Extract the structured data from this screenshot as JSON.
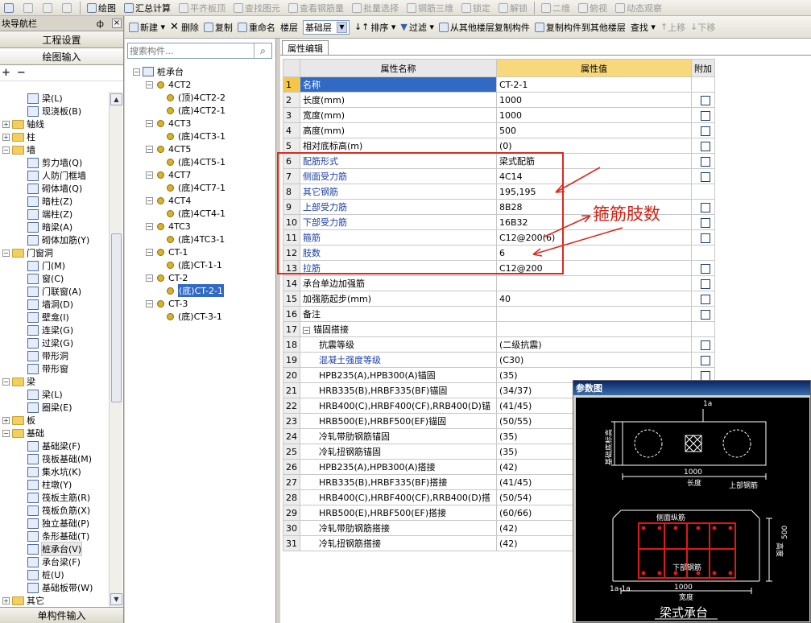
{
  "toolbar_top": {
    "items": [
      {
        "icon": "folder-open-icon",
        "label": "",
        "enabled": true
      },
      {
        "icon": "save-icon",
        "label": "",
        "enabled": false
      },
      {
        "icon": "undo-icon",
        "label": "",
        "enabled": false
      },
      {
        "icon": "redo-icon",
        "label": "",
        "enabled": false
      },
      {
        "icon": "draw-icon",
        "label": "绘图",
        "enabled": true
      },
      {
        "icon": "sigma-icon",
        "label": "汇总计算",
        "enabled": true
      },
      {
        "icon": "flat-slab-icon",
        "label": "平齐板顶",
        "enabled": false
      },
      {
        "icon": "find-element-icon",
        "label": "查找图元",
        "enabled": false
      },
      {
        "icon": "view-rebar-icon",
        "label": "查看钢筋量",
        "enabled": false
      },
      {
        "icon": "batch-select-icon",
        "label": "批量选择",
        "enabled": false
      },
      {
        "icon": "rebar-3d-icon",
        "label": "钢筋三维",
        "enabled": false
      },
      {
        "icon": "lock-icon",
        "label": "锁定",
        "enabled": false
      },
      {
        "icon": "unlock-icon",
        "label": "解锁",
        "enabled": false
      },
      {
        "icon": "2d-icon",
        "label": "二维",
        "enabled": false
      },
      {
        "icon": "view-icon",
        "label": "俯视",
        "enabled": false
      },
      {
        "icon": "dynamic-view-icon",
        "label": "动态观察",
        "enabled": false
      }
    ]
  },
  "left_panel": {
    "title": "块导航栏",
    "pin": "ф",
    "close": "×",
    "btn_project": "工程设置",
    "btn_draw": "绘图输入",
    "add_symbol": "+",
    "remove_symbol": "−",
    "tree": [
      {
        "label": "梁(L)",
        "level": 2,
        "kind": "item"
      },
      {
        "label": "现浇板(B)",
        "level": 2,
        "kind": "item"
      },
      {
        "label": "轴线",
        "level": 0,
        "kind": "folder",
        "expand": "+"
      },
      {
        "label": "柱",
        "level": 0,
        "kind": "folder",
        "expand": "+"
      },
      {
        "label": "墙",
        "level": 0,
        "kind": "folder",
        "expand": "−"
      },
      {
        "label": "剪力墙(Q)",
        "level": 2,
        "kind": "item"
      },
      {
        "label": "人防门框墙",
        "level": 2,
        "kind": "item"
      },
      {
        "label": "砌体墙(Q)",
        "level": 2,
        "kind": "item"
      },
      {
        "label": "暗柱(Z)",
        "level": 2,
        "kind": "item"
      },
      {
        "label": "端柱(Z)",
        "level": 2,
        "kind": "item"
      },
      {
        "label": "暗梁(A)",
        "level": 2,
        "kind": "item"
      },
      {
        "label": "砌体加筋(Y)",
        "level": 2,
        "kind": "item"
      },
      {
        "label": "门窗洞",
        "level": 0,
        "kind": "folder",
        "expand": "−"
      },
      {
        "label": "门(M)",
        "level": 2,
        "kind": "item"
      },
      {
        "label": "窗(C)",
        "level": 2,
        "kind": "item"
      },
      {
        "label": "门联窗(A)",
        "level": 2,
        "kind": "item"
      },
      {
        "label": "墙洞(D)",
        "level": 2,
        "kind": "item"
      },
      {
        "label": "壁龛(I)",
        "level": 2,
        "kind": "item"
      },
      {
        "label": "连梁(G)",
        "level": 2,
        "kind": "item"
      },
      {
        "label": "过梁(G)",
        "level": 2,
        "kind": "item"
      },
      {
        "label": "带形洞",
        "level": 2,
        "kind": "item"
      },
      {
        "label": "带形窗",
        "level": 2,
        "kind": "item"
      },
      {
        "label": "梁",
        "level": 0,
        "kind": "folder",
        "expand": "−"
      },
      {
        "label": "梁(L)",
        "level": 2,
        "kind": "item"
      },
      {
        "label": "圈梁(E)",
        "level": 2,
        "kind": "item"
      },
      {
        "label": "板",
        "level": 0,
        "kind": "folder",
        "expand": "+"
      },
      {
        "label": "基础",
        "level": 0,
        "kind": "folder",
        "expand": "−"
      },
      {
        "label": "基础梁(F)",
        "level": 2,
        "kind": "item"
      },
      {
        "label": "筏板基础(M)",
        "level": 2,
        "kind": "item"
      },
      {
        "label": "集水坑(K)",
        "level": 2,
        "kind": "item"
      },
      {
        "label": "柱墩(Y)",
        "level": 2,
        "kind": "item"
      },
      {
        "label": "筏板主筋(R)",
        "level": 2,
        "kind": "item"
      },
      {
        "label": "筏板负筋(X)",
        "level": 2,
        "kind": "item"
      },
      {
        "label": "独立基础(P)",
        "level": 2,
        "kind": "item"
      },
      {
        "label": "条形基础(T)",
        "level": 2,
        "kind": "item"
      },
      {
        "label": "桩承台(V)",
        "level": 2,
        "kind": "item",
        "selected": true
      },
      {
        "label": "承台梁(F)",
        "level": 2,
        "kind": "item"
      },
      {
        "label": "桩(U)",
        "level": 2,
        "kind": "item"
      },
      {
        "label": "基础板带(W)",
        "level": 2,
        "kind": "item"
      },
      {
        "label": "其它",
        "level": 0,
        "kind": "folder",
        "expand": "+"
      }
    ],
    "bottom_btn": "单构件输入"
  },
  "toolbar2": {
    "new": "新建",
    "delete": "删除",
    "copy": "复制",
    "rename": "重命名",
    "floor_label": "楼层",
    "floor_value": "基础层",
    "sort": "排序",
    "filter": "过滤",
    "copy_from": "从其他楼层复制构件",
    "copy_to": "复制构件到其他楼层",
    "find": "查找",
    "up": "上移",
    "down": "下移"
  },
  "component_tree": {
    "search_placeholder": "搜索构件...",
    "root": "桩承台",
    "groups": [
      {
        "name": "4CT2",
        "children": [
          "(顶)4CT2-2",
          "(底)4CT2-1"
        ]
      },
      {
        "name": "4CT3",
        "children": [
          "(底)4CT3-1"
        ]
      },
      {
        "name": "4CT5",
        "children": [
          "(底)4CT5-1"
        ]
      },
      {
        "name": "4CT7",
        "children": [
          "(底)4CT7-1"
        ]
      },
      {
        "name": "4CT4",
        "children": [
          "(底)4CT4-1"
        ]
      },
      {
        "name": "4TC3",
        "children": [
          "(底)4TC3-1"
        ]
      },
      {
        "name": "CT-1",
        "children": [
          "(底)CT-1-1"
        ]
      },
      {
        "name": "CT-2",
        "children": [
          "(底)CT-2-1"
        ]
      },
      {
        "name": "CT-3",
        "children": [
          "(底)CT-3-1"
        ]
      }
    ],
    "selected": "(底)CT-2-1"
  },
  "property_panel": {
    "tab": "属性编辑",
    "col_name": "属性名称",
    "col_value": "属性值",
    "col_extra": "附加",
    "rows": [
      {
        "n": "1",
        "name": "名称",
        "value": "CT-2-1",
        "blue": true,
        "check": false
      },
      {
        "n": "2",
        "name": "长度(mm)",
        "value": "1000",
        "check": true
      },
      {
        "n": "3",
        "name": "宽度(mm)",
        "value": "1000",
        "check": true
      },
      {
        "n": "4",
        "name": "高度(mm)",
        "value": "500",
        "check": true
      },
      {
        "n": "5",
        "name": "相对底标高(m)",
        "value": "(0)",
        "check": true
      },
      {
        "n": "6",
        "name": "配筋形式",
        "value": "梁式配筋",
        "blue": true,
        "check": true
      },
      {
        "n": "7",
        "name": "侧面受力筋",
        "value": "4C14",
        "blue": true,
        "check": true
      },
      {
        "n": "8",
        "name": "其它钢筋",
        "value": "195,195",
        "blue": true,
        "check": false
      },
      {
        "n": "9",
        "name": "上部受力筋",
        "value": "8B28",
        "blue": true,
        "check": true
      },
      {
        "n": "10",
        "name": "下部受力筋",
        "value": "16B32",
        "blue": true,
        "check": true
      },
      {
        "n": "11",
        "name": "箍筋",
        "value": "C12@200(6)",
        "blue": true,
        "check": true
      },
      {
        "n": "12",
        "name": "肢数",
        "value": "6",
        "blue": true,
        "check": false
      },
      {
        "n": "13",
        "name": "拉筋",
        "value": "C12@200",
        "blue": true,
        "check": true
      },
      {
        "n": "14",
        "name": "承台单边加强筋",
        "value": "",
        "check": true
      },
      {
        "n": "15",
        "name": "加强筋起步(mm)",
        "value": "40",
        "check": true
      },
      {
        "n": "16",
        "name": "备注",
        "value": "",
        "check": true
      },
      {
        "n": "17",
        "name": "锚固搭接",
        "value": "",
        "group": "−"
      },
      {
        "n": "18",
        "name": "抗震等级",
        "value": "(二级抗震)",
        "indent": true,
        "check": true
      },
      {
        "n": "19",
        "name": "混凝土强度等级",
        "value": "(C30)",
        "indent": true,
        "blue": true,
        "check": true
      },
      {
        "n": "20",
        "name": "HPB235(A),HPB300(A)锚固",
        "value": "(35)",
        "indent": true,
        "check": true
      },
      {
        "n": "21",
        "name": "HRB335(B),HRBF335(BF)锚固",
        "value": "(34/37)",
        "indent": true,
        "check": true
      },
      {
        "n": "22",
        "name": "HRB400(C),HRBF400(CF),RRB400(D)锚",
        "value": "(41/45)",
        "indent": true,
        "check": true
      },
      {
        "n": "23",
        "name": "HRB500(E),HRBF500(EF)锚固",
        "value": "(50/55)",
        "indent": true,
        "check": true
      },
      {
        "n": "24",
        "name": "冷轧带肋钢筋锚固",
        "value": "(35)",
        "indent": true,
        "check": true
      },
      {
        "n": "25",
        "name": "冷轧扭钢筋锚固",
        "value": "(35)",
        "indent": true,
        "check": true
      },
      {
        "n": "26",
        "name": "HPB235(A),HPB300(A)搭接",
        "value": "(42)",
        "indent": true,
        "check": true
      },
      {
        "n": "27",
        "name": "HRB335(B),HRBF335(BF)搭接",
        "value": "(41/45)",
        "indent": true,
        "check": true
      },
      {
        "n": "28",
        "name": "HRB400(C),HRBF400(CF),RRB400(D)搭",
        "value": "(50/54)",
        "indent": true,
        "check": true
      },
      {
        "n": "29",
        "name": "HRB500(E),HRBF500(EF)搭接",
        "value": "(60/66)",
        "indent": true,
        "check": true
      },
      {
        "n": "30",
        "name": "冷轧带肋钢筋搭接",
        "value": "(42)",
        "indent": true,
        "check": true
      },
      {
        "n": "31",
        "name": "冷轧扭钢筋搭接",
        "value": "(42)",
        "indent": true,
        "check": true
      }
    ]
  },
  "annotation": {
    "text": "箍筋肢数",
    "color": "#d62114"
  },
  "param_window": {
    "title": "参数图",
    "label_top_dim": "1000",
    "label_length": "长度",
    "label_top_rebar": "上部钢筋",
    "label_side_rebar": "侧面纵筋",
    "label_bottom_rebar": "下部钢筋",
    "label_bottom_dim": "1000",
    "label_width": "宽度",
    "label_section": "1a-1a",
    "label_height": "高度",
    "label_height_dim": "500",
    "label_base_elev": "基础底标高",
    "label_section_mark": "1a",
    "caption": "梁式承台"
  }
}
